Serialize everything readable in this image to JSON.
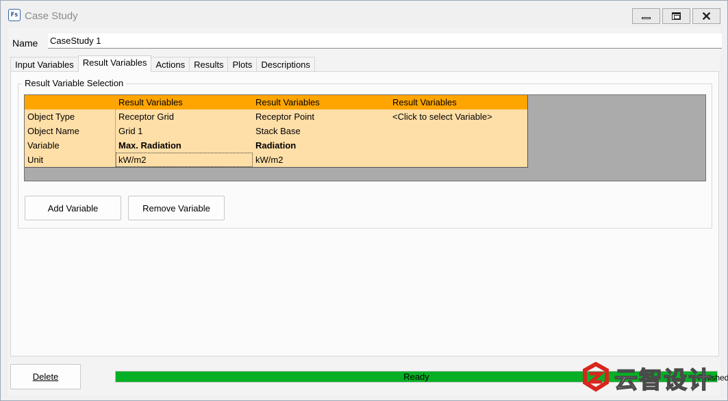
{
  "window": {
    "title": "Case Study",
    "icon": "fs-app-icon",
    "icon_text": "Fs"
  },
  "name": {
    "label": "Name",
    "value": "CaseStudy 1"
  },
  "tabs": [
    {
      "label": "Input Variables"
    },
    {
      "label": "Result Variables",
      "active": true
    },
    {
      "label": "Actions"
    },
    {
      "label": "Results"
    },
    {
      "label": "Plots"
    },
    {
      "label": "Descriptions"
    }
  ],
  "selection": {
    "title": "Result Variable Selection",
    "header": [
      "",
      "Result Variables",
      "Result Variables",
      "Result Variables"
    ],
    "rows": [
      [
        "Object Type",
        "Receptor Grid",
        "Receptor Point",
        "<Click to select Variable>"
      ],
      [
        "Object Name",
        "Grid 1",
        "Stack Base",
        ""
      ],
      [
        "Variable",
        "Max. Radiation",
        "Radiation",
        ""
      ],
      [
        "Unit",
        "kW/m2",
        "kW/m2",
        ""
      ]
    ],
    "colors": {
      "header": "#ffa500",
      "cells": "#ffdfa8",
      "empty_area": "#ababab"
    }
  },
  "buttons": {
    "add_variable": "Add Variable",
    "remove_variable": "Remove Variable",
    "delete": "Delete"
  },
  "status": {
    "progress_text": "Ready",
    "progress_fraction": 1.0,
    "progress_color": "#06b025",
    "right_text": "Finished"
  },
  "watermark": {
    "text": "云智设计"
  }
}
